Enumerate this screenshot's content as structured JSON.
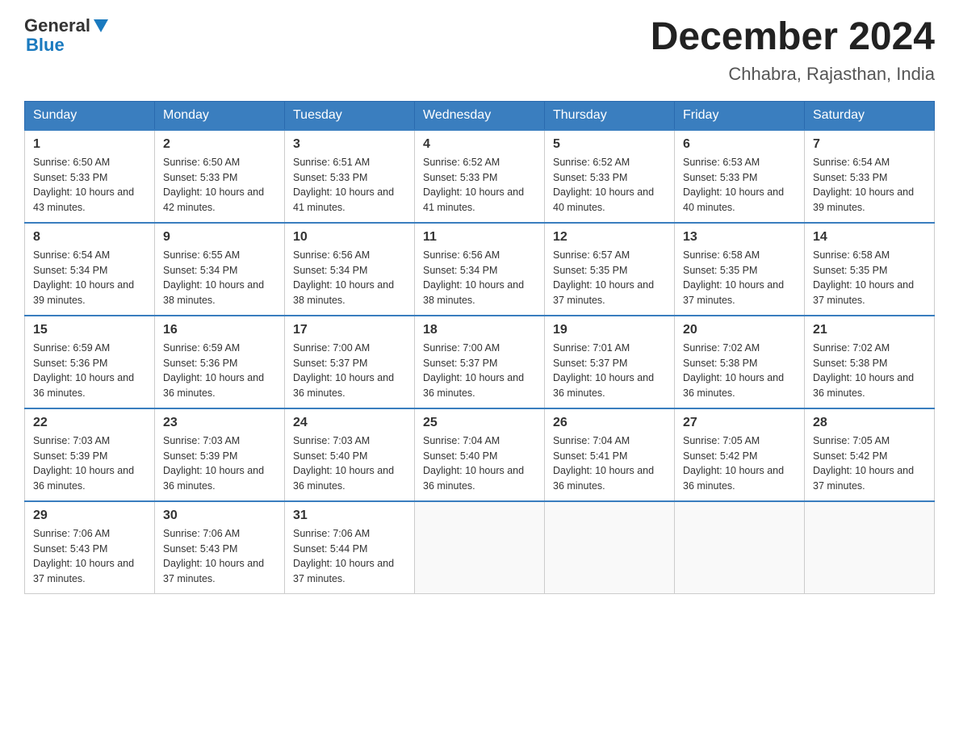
{
  "header": {
    "logo_general": "General",
    "logo_blue": "Blue",
    "title": "December 2024",
    "subtitle": "Chhabra, Rajasthan, India"
  },
  "days_of_week": [
    "Sunday",
    "Monday",
    "Tuesday",
    "Wednesday",
    "Thursday",
    "Friday",
    "Saturday"
  ],
  "weeks": [
    [
      {
        "day": "1",
        "sunrise": "6:50 AM",
        "sunset": "5:33 PM",
        "daylight": "10 hours and 43 minutes."
      },
      {
        "day": "2",
        "sunrise": "6:50 AM",
        "sunset": "5:33 PM",
        "daylight": "10 hours and 42 minutes."
      },
      {
        "day": "3",
        "sunrise": "6:51 AM",
        "sunset": "5:33 PM",
        "daylight": "10 hours and 41 minutes."
      },
      {
        "day": "4",
        "sunrise": "6:52 AM",
        "sunset": "5:33 PM",
        "daylight": "10 hours and 41 minutes."
      },
      {
        "day": "5",
        "sunrise": "6:52 AM",
        "sunset": "5:33 PM",
        "daylight": "10 hours and 40 minutes."
      },
      {
        "day": "6",
        "sunrise": "6:53 AM",
        "sunset": "5:33 PM",
        "daylight": "10 hours and 40 minutes."
      },
      {
        "day": "7",
        "sunrise": "6:54 AM",
        "sunset": "5:33 PM",
        "daylight": "10 hours and 39 minutes."
      }
    ],
    [
      {
        "day": "8",
        "sunrise": "6:54 AM",
        "sunset": "5:34 PM",
        "daylight": "10 hours and 39 minutes."
      },
      {
        "day": "9",
        "sunrise": "6:55 AM",
        "sunset": "5:34 PM",
        "daylight": "10 hours and 38 minutes."
      },
      {
        "day": "10",
        "sunrise": "6:56 AM",
        "sunset": "5:34 PM",
        "daylight": "10 hours and 38 minutes."
      },
      {
        "day": "11",
        "sunrise": "6:56 AM",
        "sunset": "5:34 PM",
        "daylight": "10 hours and 38 minutes."
      },
      {
        "day": "12",
        "sunrise": "6:57 AM",
        "sunset": "5:35 PM",
        "daylight": "10 hours and 37 minutes."
      },
      {
        "day": "13",
        "sunrise": "6:58 AM",
        "sunset": "5:35 PM",
        "daylight": "10 hours and 37 minutes."
      },
      {
        "day": "14",
        "sunrise": "6:58 AM",
        "sunset": "5:35 PM",
        "daylight": "10 hours and 37 minutes."
      }
    ],
    [
      {
        "day": "15",
        "sunrise": "6:59 AM",
        "sunset": "5:36 PM",
        "daylight": "10 hours and 36 minutes."
      },
      {
        "day": "16",
        "sunrise": "6:59 AM",
        "sunset": "5:36 PM",
        "daylight": "10 hours and 36 minutes."
      },
      {
        "day": "17",
        "sunrise": "7:00 AM",
        "sunset": "5:37 PM",
        "daylight": "10 hours and 36 minutes."
      },
      {
        "day": "18",
        "sunrise": "7:00 AM",
        "sunset": "5:37 PM",
        "daylight": "10 hours and 36 minutes."
      },
      {
        "day": "19",
        "sunrise": "7:01 AM",
        "sunset": "5:37 PM",
        "daylight": "10 hours and 36 minutes."
      },
      {
        "day": "20",
        "sunrise": "7:02 AM",
        "sunset": "5:38 PM",
        "daylight": "10 hours and 36 minutes."
      },
      {
        "day": "21",
        "sunrise": "7:02 AM",
        "sunset": "5:38 PM",
        "daylight": "10 hours and 36 minutes."
      }
    ],
    [
      {
        "day": "22",
        "sunrise": "7:03 AM",
        "sunset": "5:39 PM",
        "daylight": "10 hours and 36 minutes."
      },
      {
        "day": "23",
        "sunrise": "7:03 AM",
        "sunset": "5:39 PM",
        "daylight": "10 hours and 36 minutes."
      },
      {
        "day": "24",
        "sunrise": "7:03 AM",
        "sunset": "5:40 PM",
        "daylight": "10 hours and 36 minutes."
      },
      {
        "day": "25",
        "sunrise": "7:04 AM",
        "sunset": "5:40 PM",
        "daylight": "10 hours and 36 minutes."
      },
      {
        "day": "26",
        "sunrise": "7:04 AM",
        "sunset": "5:41 PM",
        "daylight": "10 hours and 36 minutes."
      },
      {
        "day": "27",
        "sunrise": "7:05 AM",
        "sunset": "5:42 PM",
        "daylight": "10 hours and 36 minutes."
      },
      {
        "day": "28",
        "sunrise": "7:05 AM",
        "sunset": "5:42 PM",
        "daylight": "10 hours and 37 minutes."
      }
    ],
    [
      {
        "day": "29",
        "sunrise": "7:06 AM",
        "sunset": "5:43 PM",
        "daylight": "10 hours and 37 minutes."
      },
      {
        "day": "30",
        "sunrise": "7:06 AM",
        "sunset": "5:43 PM",
        "daylight": "10 hours and 37 minutes."
      },
      {
        "day": "31",
        "sunrise": "7:06 AM",
        "sunset": "5:44 PM",
        "daylight": "10 hours and 37 minutes."
      },
      null,
      null,
      null,
      null
    ]
  ],
  "labels": {
    "sunrise_prefix": "Sunrise: ",
    "sunset_prefix": "Sunset: ",
    "daylight_prefix": "Daylight: "
  }
}
